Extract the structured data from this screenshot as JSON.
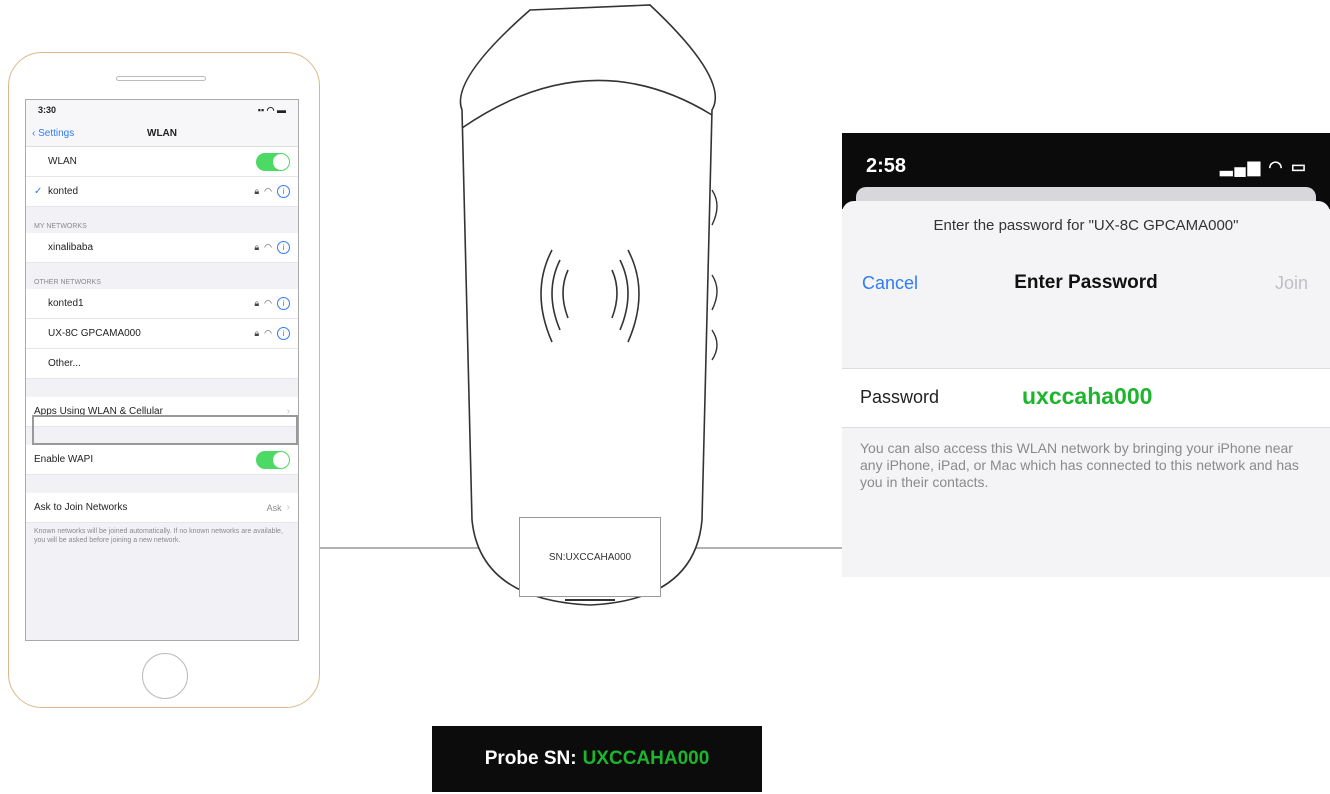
{
  "phone": {
    "status": {
      "time": "3:30",
      "icons": "signal-wifi-battery"
    },
    "nav": {
      "back": "Settings",
      "title": "WLAN"
    },
    "wlan_row": {
      "label": "WLAN"
    },
    "connected": {
      "label": "konted"
    },
    "my_networks": {
      "header": "MY NETWORKS",
      "items": [
        {
          "label": "xinalibaba"
        }
      ]
    },
    "other_networks": {
      "header": "OTHER NETWORKS",
      "items": [
        {
          "label": "konted1"
        },
        {
          "label": "UX-8C GPCAMA000"
        }
      ],
      "other": "Other..."
    },
    "apps_row": {
      "label": "Apps Using WLAN & Cellular"
    },
    "wapi_row": {
      "label": "Enable WAPI"
    },
    "ask_row": {
      "label": "Ask to Join Networks",
      "value": "Ask"
    },
    "footer": "Known networks will be joined automatically. If no known networks are available, you will be asked before joining a new network."
  },
  "probe": {
    "sn_box": "SN:UXCCAHA000"
  },
  "password_dialog": {
    "time": "2:58",
    "prompt": "Enter the password for \"UX-8C GPCAMA000\"",
    "cancel": "Cancel",
    "title": "Enter Password",
    "join": "Join",
    "field_label": "Password",
    "field_value": "uxccaha000",
    "hint": "You can also access this WLAN network by bringing your iPhone near any iPhone, iPad, or Mac which has connected to this network and has you in their contacts."
  },
  "sn_label": {
    "prefix": "Probe SN:",
    "value": "UXCCAHA000"
  },
  "colors": {
    "accent": "#2f7cf6",
    "highlight": "#1db52c",
    "toggle": "#4cd964"
  }
}
